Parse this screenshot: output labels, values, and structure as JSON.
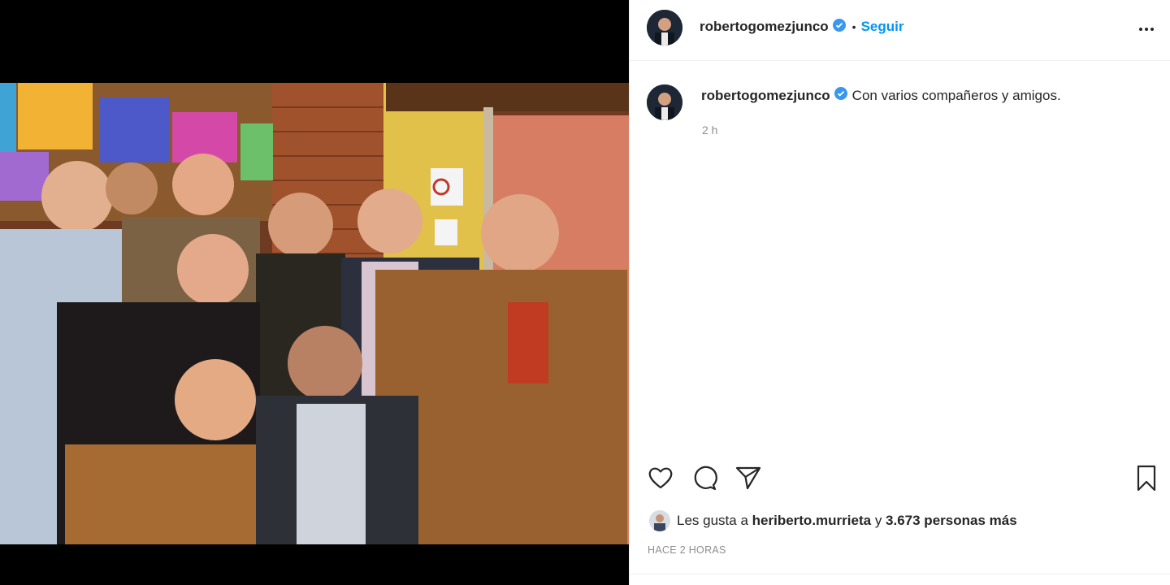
{
  "post": {
    "username": "robertogomezjunco",
    "follow_label": "Seguir",
    "separator": "•",
    "more_icon": "more-options-icon",
    "verified_color": "#3897f0"
  },
  "caption": {
    "username": "robertogomezjunco",
    "text": "Con varios compañeros y amigos.",
    "time": "2 h"
  },
  "actions": {
    "icons": [
      "heart-icon",
      "comment-icon",
      "share-icon",
      "bookmark-icon"
    ]
  },
  "likes": {
    "prefix": "Les gusta a",
    "user": "heriberto.murrieta",
    "connector": "y",
    "count": "3.673 personas más"
  },
  "timestamp": "HACE 2 HORAS",
  "colors": {
    "link": "#0095f6",
    "text": "#262626",
    "muted": "#8e8e8e"
  }
}
